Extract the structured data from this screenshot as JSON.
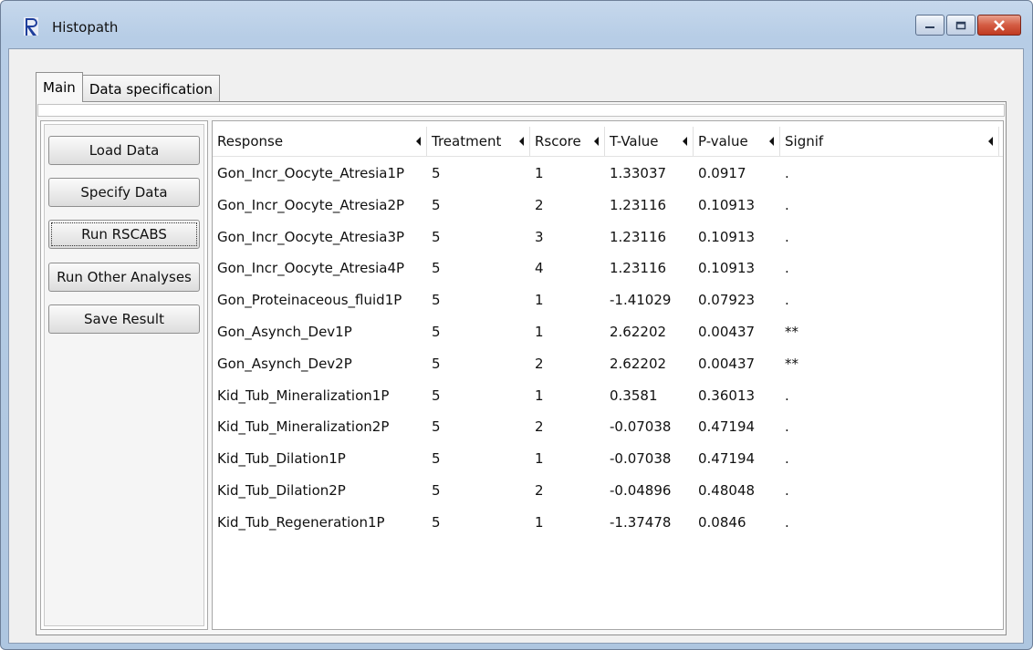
{
  "window": {
    "title": "Histopath"
  },
  "tabs": [
    "Main",
    "Data specification"
  ],
  "buttons": {
    "load": "Load Data",
    "specify": "Specify Data",
    "run_rscabs": "Run RSCABS",
    "run_other": "Run Other Analyses",
    "save": "Save Result"
  },
  "table": {
    "columns": [
      "Response",
      "Treatment",
      "Rscore",
      "T-Value",
      "P-value",
      "Signif"
    ],
    "rows": [
      [
        "Gon_Incr_Oocyte_Atresia1P",
        "5",
        "1",
        "1.33037",
        "0.0917",
        "."
      ],
      [
        "Gon_Incr_Oocyte_Atresia2P",
        "5",
        "2",
        "1.23116",
        "0.10913",
        "."
      ],
      [
        "Gon_Incr_Oocyte_Atresia3P",
        "5",
        "3",
        "1.23116",
        "0.10913",
        "."
      ],
      [
        "Gon_Incr_Oocyte_Atresia4P",
        "5",
        "4",
        "1.23116",
        "0.10913",
        "."
      ],
      [
        "Gon_Proteinaceous_fluid1P",
        "5",
        "1",
        "-1.41029",
        "0.07923",
        "."
      ],
      [
        "Gon_Asynch_Dev1P",
        "5",
        "1",
        "2.62202",
        "0.00437",
        "**"
      ],
      [
        "Gon_Asynch_Dev2P",
        "5",
        "2",
        "2.62202",
        "0.00437",
        "**"
      ],
      [
        "Kid_Tub_Mineralization1P",
        "5",
        "1",
        "0.3581",
        "0.36013",
        "."
      ],
      [
        "Kid_Tub_Mineralization2P",
        "5",
        "2",
        "-0.07038",
        "0.47194",
        "."
      ],
      [
        "Kid_Tub_Dilation1P",
        "5",
        "1",
        "-0.07038",
        "0.47194",
        "."
      ],
      [
        "Kid_Tub_Dilation2P",
        "5",
        "2",
        "-0.04896",
        "0.48048",
        "."
      ],
      [
        "Kid_Tub_Regeneration1P",
        "5",
        "1",
        "-1.37478",
        "0.0846",
        "."
      ]
    ]
  },
  "icons": {
    "app": "r-logo-icon",
    "minimize": "minimize-icon",
    "maximize": "maximize-icon",
    "close": "close-icon",
    "sort": "sort-arrow-icon"
  },
  "colors": {
    "titlebar": "#b7cde6",
    "close": "#c84a30",
    "r_logo": "#1e3e9c"
  }
}
